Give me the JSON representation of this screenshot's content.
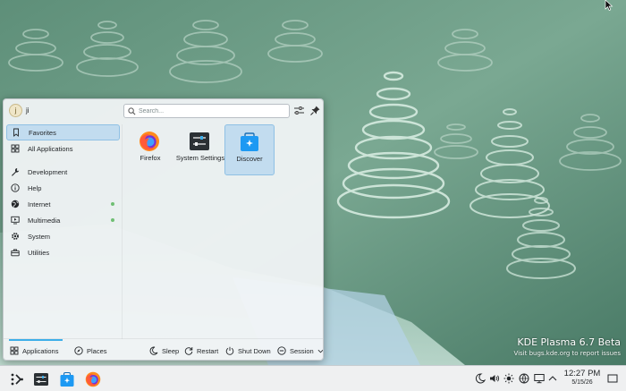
{
  "desktop": {
    "watermark_title": "KDE Plasma 6.7 Beta",
    "watermark_subtitle": "Visit bugs.kde.org to report issues"
  },
  "launcher": {
    "user_initial": "j",
    "username": "ji",
    "search_placeholder": "Search...",
    "sidebar": [
      {
        "label": "Favorites",
        "icon": "bookmark-icon",
        "active": true
      },
      {
        "label": "All Applications",
        "icon": "grid-icon"
      },
      {
        "label": "Development",
        "icon": "wrench-icon"
      },
      {
        "label": "Help",
        "icon": "info-icon"
      },
      {
        "label": "Internet",
        "icon": "globe-icon",
        "new": true
      },
      {
        "label": "Multimedia",
        "icon": "monitor-play-icon",
        "new": true
      },
      {
        "label": "System",
        "icon": "gear-icon"
      },
      {
        "label": "Utilities",
        "icon": "toolbox-icon"
      }
    ],
    "favorites": [
      {
        "label": "Firefox",
        "icon": "firefox-icon"
      },
      {
        "label": "System Settings",
        "icon": "system-settings-icon"
      },
      {
        "label": "Discover",
        "icon": "discover-icon",
        "selected": true
      }
    ],
    "footer": {
      "tab_applications": "Applications",
      "tab_places": "Places",
      "sleep": "Sleep",
      "restart": "Restart",
      "shut_down": "Shut Down",
      "session": "Session"
    }
  },
  "panel": {
    "tasks": [
      "kickoff-launcher-icon",
      "system-settings-icon",
      "discover-icon",
      "firefox-icon"
    ],
    "tray": [
      "night-mode-icon",
      "volume-icon",
      "brightness-icon",
      "network-icon",
      "display-icon",
      "expand-arrow-icon"
    ],
    "clock_time": "12:27 PM",
    "clock_date": "5/15/26"
  },
  "colors": {
    "accent": "#3daee9",
    "selection": "#c2dcef",
    "panel": "#eff0f1",
    "new_dot": "#6fbf73"
  }
}
